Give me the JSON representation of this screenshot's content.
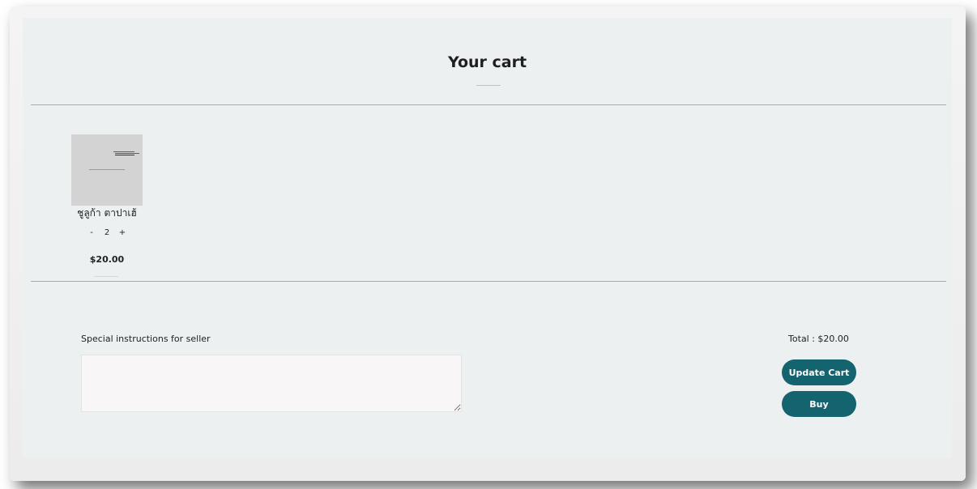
{
  "page": {
    "title": "Your cart"
  },
  "cart": {
    "items": [
      {
        "name": "ชูลูก้า ตาปาเฮ้",
        "quantity": "2",
        "decrement_label": "-",
        "increment_label": "+",
        "price": "$20.00"
      }
    ]
  },
  "instructions": {
    "label": "Special instructions for seller",
    "value": "",
    "placeholder": ""
  },
  "summary": {
    "total": "Total : $20.00",
    "update_label": "Update Cart",
    "buy_label": "Buy"
  },
  "colors": {
    "accent": "#14646f",
    "page_background": "#ecf0f0"
  }
}
